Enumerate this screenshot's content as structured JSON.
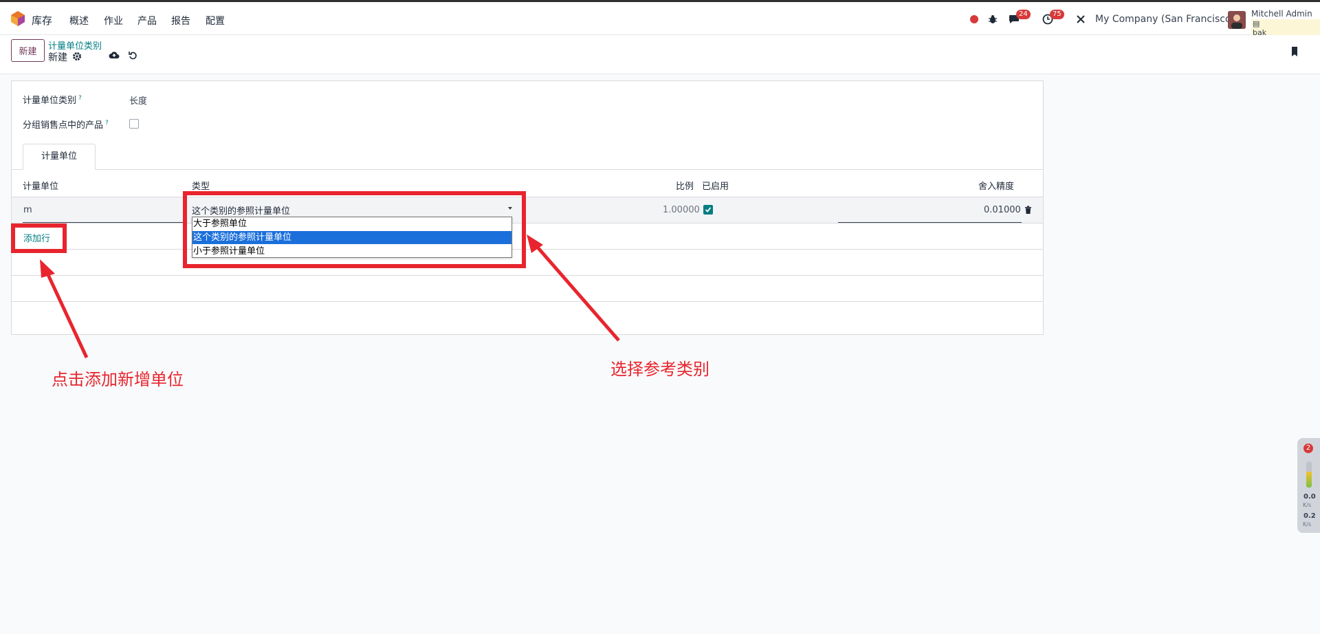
{
  "topbar": {
    "app_name": "库存",
    "menu": [
      "概述",
      "作业",
      "产品",
      "报告",
      "配置"
    ],
    "messages_count": "24",
    "activities_count": "75",
    "company": "My Company (San Francisco)",
    "user_name": "Mitchell Admin",
    "db_name": "bak"
  },
  "control": {
    "new_label": "新建",
    "breadcrumb": "计量单位类别",
    "record_title": "新建"
  },
  "form": {
    "category_label": "计量单位类别",
    "category_value": "长度",
    "pos_group_label": "分组销售点中的产品",
    "help_mark": "?",
    "tab_label": "计量单位"
  },
  "grid": {
    "headers": {
      "uom": "计量单位",
      "type": "类型",
      "ratio": "比例",
      "active": "已启用",
      "rounding": "舍入精度"
    },
    "row": {
      "uom": "m",
      "type": "这个类别的参照计量单位",
      "ratio": "1.00000",
      "active": true,
      "rounding": "0.01000"
    },
    "add_line": "添加行"
  },
  "dropdown": {
    "options": [
      "大于参照单位",
      "这个类别的参照计量单位",
      "小于参照计量单位"
    ],
    "selected_index": 1
  },
  "annotations": {
    "left_text": "点击添加新增单位",
    "right_text": "选择参考类别",
    "color": "#e8252e"
  },
  "side_widget": {
    "badge": "2",
    "up_value": "0.0",
    "up_unit": "K/s",
    "down_value": "0.2",
    "down_unit": "K/s"
  },
  "colors": {
    "accent": "#017e84",
    "brand": "#71385a",
    "badge": "#d63a3a",
    "selection": "#1a6fdb"
  }
}
